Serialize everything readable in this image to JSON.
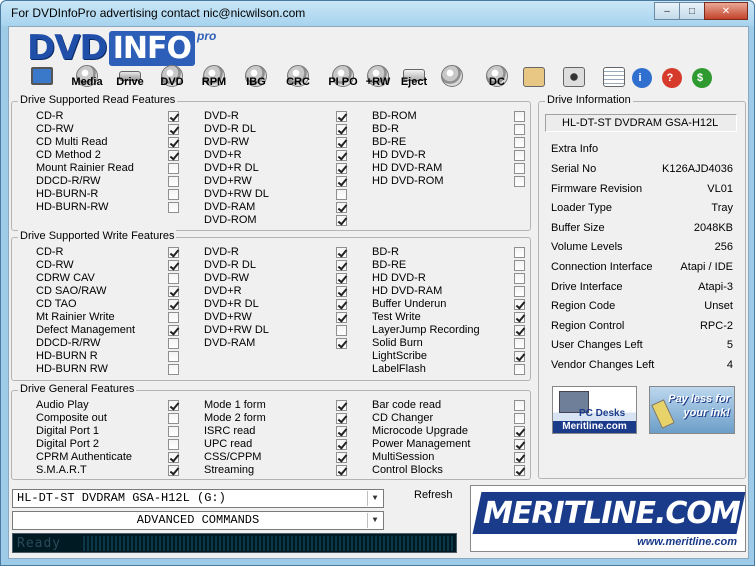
{
  "window": {
    "title": "For DVDInfoPro advertising contact nic@nicwilson.com",
    "minimize": "–",
    "maximize": "□",
    "close": "✕"
  },
  "logo": {
    "dvd": "DVD",
    "info": "INFO",
    "pro": "pro"
  },
  "toolbar": [
    {
      "name": "drive-tool",
      "label": "",
      "icon": "monitor-icon"
    },
    {
      "name": "media-tool",
      "label": "Media",
      "icon": "disc-icon"
    },
    {
      "name": "drive2-tool",
      "label": "Drive",
      "icon": "drive-icon"
    },
    {
      "name": "dvd-tool",
      "label": "DVD",
      "icon": "disc-icon"
    },
    {
      "name": "rpm-tool",
      "label": "RPM",
      "icon": "disc-icon"
    },
    {
      "name": "ibg-tool",
      "label": "IBG",
      "icon": "disc-icon"
    },
    {
      "name": "crc-tool",
      "label": "CRC",
      "icon": "disc-icon"
    },
    {
      "name": "pipo-tool",
      "label": "PI PO",
      "icon": "disc-icon"
    },
    {
      "name": "plusrw-tool",
      "label": "+RW",
      "icon": "disc-icon"
    },
    {
      "name": "eject-tool",
      "label": "Eject",
      "icon": "eject-icon"
    },
    {
      "name": "burn-tool",
      "label": "",
      "icon": "disc-pen-icon"
    },
    {
      "name": "dc-tool",
      "label": "DC",
      "icon": "disc-icon"
    },
    {
      "name": "clipboard-tool",
      "label": "",
      "icon": "clipboard-icon"
    },
    {
      "name": "camera-tool",
      "label": "",
      "icon": "camera-icon"
    },
    {
      "name": "notes-tool",
      "label": "",
      "icon": "notepad-icon"
    },
    {
      "name": "info-tool",
      "label": "i",
      "icon": "info-icon"
    },
    {
      "name": "help-tool",
      "label": "?",
      "icon": "help-icon"
    },
    {
      "name": "money-tool",
      "label": "$",
      "icon": "dollar-icon"
    }
  ],
  "read_features": {
    "title": "Drive Supported Read Features",
    "columns": [
      [
        {
          "label": "CD-R",
          "checked": true
        },
        {
          "label": "CD-RW",
          "checked": true
        },
        {
          "label": "CD Multi Read",
          "checked": true
        },
        {
          "label": "CD Method 2",
          "checked": true
        },
        {
          "label": "Mount Rainier Read",
          "checked": false
        },
        {
          "label": "DDCD-R/RW",
          "checked": false
        },
        {
          "label": "HD-BURN-R",
          "checked": false
        },
        {
          "label": "HD-BURN-RW",
          "checked": false
        }
      ],
      [
        {
          "label": "DVD-R",
          "checked": true
        },
        {
          "label": "DVD-R DL",
          "checked": true
        },
        {
          "label": "DVD-RW",
          "checked": true
        },
        {
          "label": "DVD+R",
          "checked": true
        },
        {
          "label": "DVD+R DL",
          "checked": true
        },
        {
          "label": "DVD+RW",
          "checked": true
        },
        {
          "label": "DVD+RW DL",
          "checked": false
        },
        {
          "label": "DVD-RAM",
          "checked": true
        },
        {
          "label": "DVD-ROM",
          "checked": true
        }
      ],
      [
        {
          "label": "BD-ROM",
          "checked": false
        },
        {
          "label": "BD-R",
          "checked": false
        },
        {
          "label": "BD-RE",
          "checked": false
        },
        {
          "label": "HD DVD-R",
          "checked": false
        },
        {
          "label": "HD DVD-RAM",
          "checked": false
        },
        {
          "label": "HD DVD-ROM",
          "checked": false
        }
      ]
    ]
  },
  "write_features": {
    "title": "Drive Supported Write Features",
    "columns": [
      [
        {
          "label": "CD-R",
          "checked": true
        },
        {
          "label": "CD-RW",
          "checked": true
        },
        {
          "label": "CDRW CAV",
          "checked": false
        },
        {
          "label": "CD SAO/RAW",
          "checked": true
        },
        {
          "label": "CD TAO",
          "checked": true
        },
        {
          "label": "Mt Rainier Write",
          "checked": false
        },
        {
          "label": "Defect Management",
          "checked": true
        },
        {
          "label": "DDCD-R/RW",
          "checked": false
        },
        {
          "label": "HD-BURN R",
          "checked": false
        },
        {
          "label": "HD-BURN RW",
          "checked": false
        }
      ],
      [
        {
          "label": "DVD-R",
          "checked": true
        },
        {
          "label": "DVD-R DL",
          "checked": true
        },
        {
          "label": "DVD-RW",
          "checked": true
        },
        {
          "label": "DVD+R",
          "checked": true
        },
        {
          "label": "DVD+R DL",
          "checked": true
        },
        {
          "label": "DVD+RW",
          "checked": true
        },
        {
          "label": "DVD+RW DL",
          "checked": false
        },
        {
          "label": "DVD-RAM",
          "checked": true
        }
      ],
      [
        {
          "label": "BD-R",
          "checked": false
        },
        {
          "label": "BD-RE",
          "checked": false
        },
        {
          "label": "HD DVD-R",
          "checked": false
        },
        {
          "label": "HD DVD-RAM",
          "checked": false
        },
        {
          "label": "Buffer Underun",
          "checked": true
        },
        {
          "label": "Test Write",
          "checked": true
        },
        {
          "label": "LayerJump Recording",
          "checked": true
        },
        {
          "label": "Solid Burn",
          "checked": false
        },
        {
          "label": "LightScribe",
          "checked": true
        },
        {
          "label": "LabelFlash",
          "checked": false
        }
      ]
    ]
  },
  "general_features": {
    "title": "Drive General Features",
    "columns": [
      [
        {
          "label": "Audio Play",
          "checked": true
        },
        {
          "label": "Composite out",
          "checked": false
        },
        {
          "label": "Digital Port 1",
          "checked": false
        },
        {
          "label": "Digital Port 2",
          "checked": false
        },
        {
          "label": "CPRM Authenticate",
          "checked": true
        },
        {
          "label": "S.M.A.R.T",
          "checked": true
        }
      ],
      [
        {
          "label": "Mode 1 form",
          "checked": true
        },
        {
          "label": "Mode 2 form",
          "checked": true
        },
        {
          "label": "ISRC read",
          "checked": true
        },
        {
          "label": "UPC read",
          "checked": true
        },
        {
          "label": "CSS/CPPM",
          "checked": true
        },
        {
          "label": "Streaming",
          "checked": true
        }
      ],
      [
        {
          "label": "Bar code read",
          "checked": false
        },
        {
          "label": "CD Changer",
          "checked": false
        },
        {
          "label": "Microcode Upgrade",
          "checked": true
        },
        {
          "label": "Power Management",
          "checked": true
        },
        {
          "label": "MultiSession",
          "checked": true
        },
        {
          "label": "Control Blocks",
          "checked": true
        }
      ]
    ]
  },
  "drive_info": {
    "title": "Drive Information",
    "drive_name": "HL-DT-ST DVDRAM GSA-H12L",
    "extra_info": "Extra Info",
    "rows": [
      {
        "label": "Serial No",
        "value": "K126AJD4036"
      },
      {
        "label": "Firmware Revision",
        "value": "VL01"
      },
      {
        "label": "Loader Type",
        "value": "Tray"
      },
      {
        "label": "Buffer Size",
        "value": "2048KB"
      },
      {
        "label": "Volume Levels",
        "value": "256"
      },
      {
        "label": "Connection Interface",
        "value": "Atapi / IDE"
      },
      {
        "label": "Drive Interface",
        "value": "Atapi-3"
      },
      {
        "label": "Region Code",
        "value": "Unset"
      },
      {
        "label": "Region Control",
        "value": "RPC-2"
      },
      {
        "label": "User Changes Left",
        "value": "5"
      },
      {
        "label": "Vendor Changes Left",
        "value": "4"
      }
    ]
  },
  "ads": {
    "pcdesks_title": "PC Desks",
    "pcdesks_site": "Meritline.com",
    "ink_line1": "Pay less for",
    "ink_line2": "your ink!",
    "meritline_brand": "MERITLINE.COM",
    "meritline_url": "www.meritline.com"
  },
  "bottom": {
    "drive_select": "HL-DT-ST DVDRAM GSA-H12L (G:)",
    "commands_select": "ADVANCED COMMANDS",
    "refresh": "Refresh",
    "status": "Ready"
  },
  "colors": {
    "frame": "#9ecce8",
    "panel": "#f0f0f0",
    "brand_blue": "#1a3a8a",
    "status_bg": "#001a24"
  }
}
